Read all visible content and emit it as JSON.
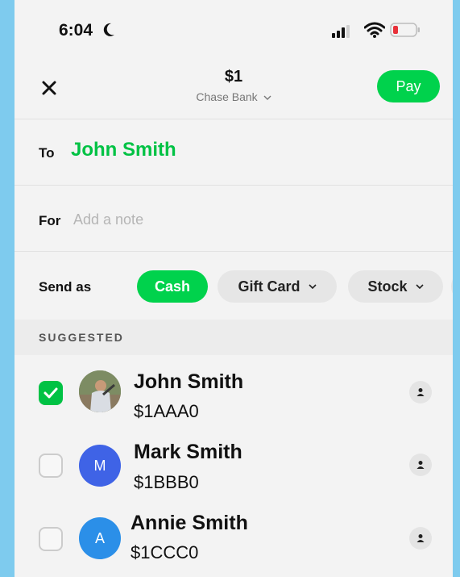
{
  "status_bar": {
    "time": "6:04"
  },
  "header": {
    "amount": "$1",
    "bank": "Chase Bank",
    "pay_label": "Pay"
  },
  "to": {
    "label": "To",
    "name": "John Smith"
  },
  "for": {
    "label": "For",
    "placeholder": "Add a note"
  },
  "send_as": {
    "label": "Send as",
    "options": [
      {
        "label": "Cash",
        "selected": true
      },
      {
        "label": "Gift Card",
        "selected": false
      },
      {
        "label": "Stock",
        "selected": false
      }
    ]
  },
  "suggested": {
    "title": "SUGGESTED",
    "contacts": [
      {
        "name": "John Smith",
        "tag": "$1AAA0",
        "checked": true,
        "avatar": "photo"
      },
      {
        "name": "Mark Smith",
        "tag": "$1BBB0",
        "checked": false,
        "avatar": "M",
        "color": "#3f63e6"
      },
      {
        "name": "Annie Smith",
        "tag": "$1CCC0",
        "checked": false,
        "avatar": "A",
        "color": "#2b8fe8"
      }
    ]
  },
  "colors": {
    "accent": "#00D24C",
    "background": "#7ECBEE"
  }
}
